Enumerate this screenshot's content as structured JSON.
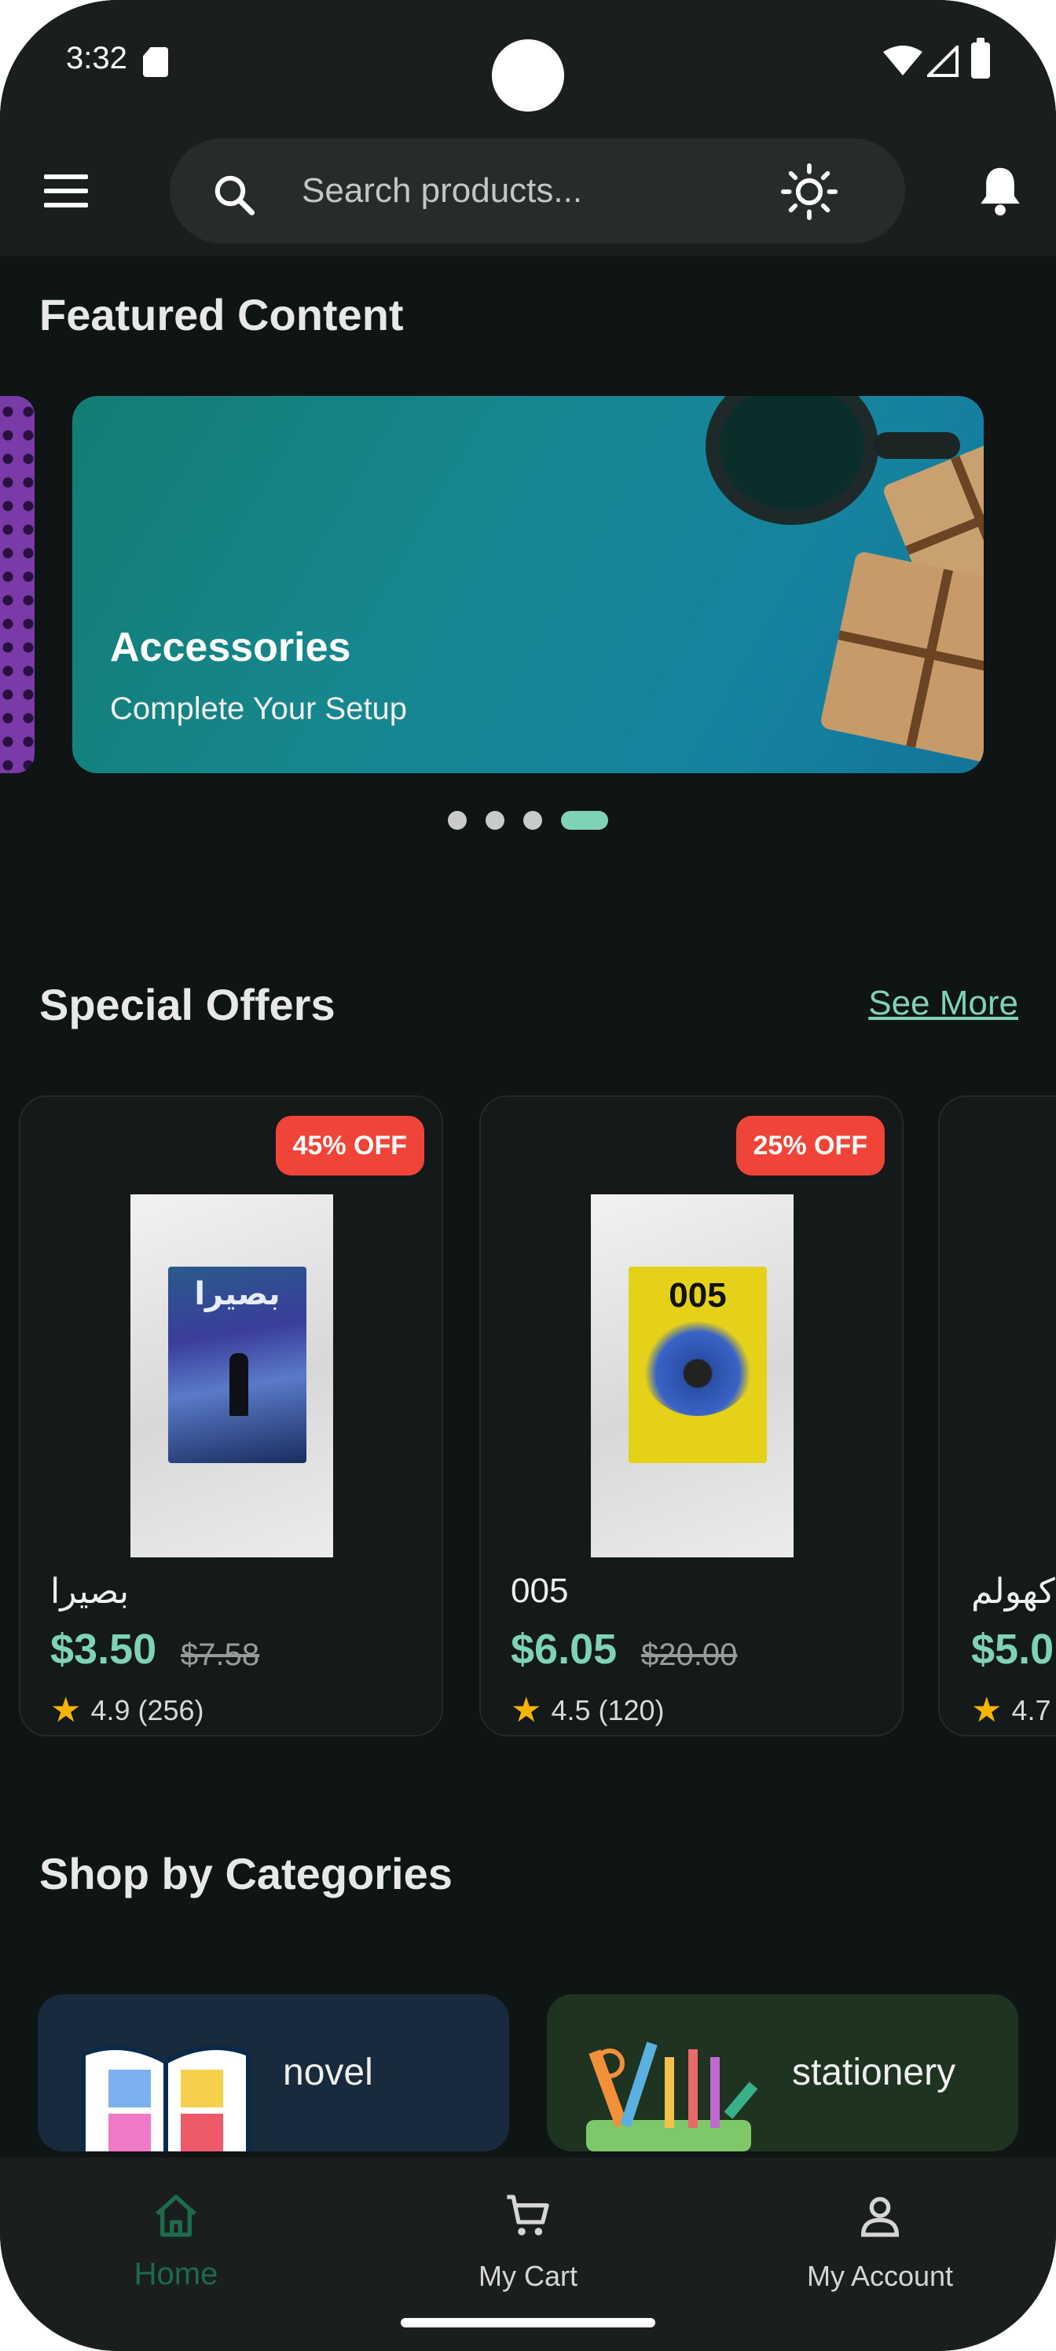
{
  "status_bar": {
    "time": "3:32"
  },
  "app_bar": {
    "search_placeholder": "Search products..."
  },
  "featured": {
    "title": "Featured Content",
    "banner_title": "Accessories",
    "banner_subtitle": "Complete Your Setup",
    "dots_count": 4,
    "active_dot": 4
  },
  "offers": {
    "title": "Special Offers",
    "see_more": "See More",
    "items": [
      {
        "name": "بصيرا",
        "cover_title": "بصيرا",
        "price": "$3.50",
        "old_price": "$7.58",
        "discount": "45% OFF",
        "rating": "4.9 (256)"
      },
      {
        "name": "005",
        "cover_title": "005",
        "price": "$6.05",
        "old_price": "$20.00",
        "discount": "25% OFF",
        "rating": "4.5 (120)"
      },
      {
        "name": "كهولم",
        "price": "$5.0",
        "rating": "4.7"
      }
    ]
  },
  "categories": {
    "title": "Shop by Categories",
    "items": [
      {
        "label": "novel",
        "color": "#182a3c"
      },
      {
        "label": "stationery",
        "color": "#1e3320"
      }
    ]
  },
  "bottom_nav": {
    "items": [
      {
        "label": "Home",
        "icon": "home-icon",
        "active": true
      },
      {
        "label": "My Cart",
        "icon": "cart-icon",
        "active": false
      },
      {
        "label": "My Account",
        "icon": "account-icon",
        "active": false
      }
    ]
  },
  "colors": {
    "accent": "#7fd3b5",
    "discount_badge": "#ef4437",
    "background": "#0f1414",
    "bar": "#1b1e1e",
    "active_nav": "#1d6b4c"
  }
}
